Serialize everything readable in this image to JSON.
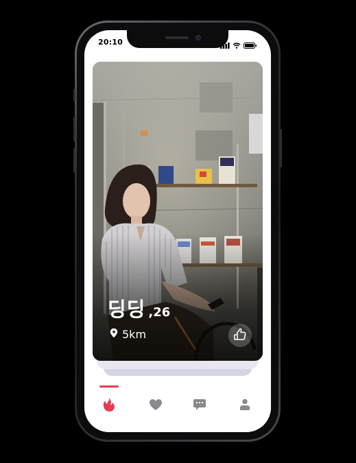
{
  "status_bar": {
    "time": "20:10"
  },
  "profile": {
    "name": "딩딩",
    "age": ",26",
    "distance": "5km"
  },
  "tabs": [
    {
      "icon": "flame-icon",
      "active": true
    },
    {
      "icon": "heart-icon",
      "active": false
    },
    {
      "icon": "chat-icon",
      "active": false
    },
    {
      "icon": "person-icon",
      "active": false
    }
  ],
  "colors": {
    "accent": "#e53b54",
    "inactive_icon": "#8a8a8e"
  }
}
